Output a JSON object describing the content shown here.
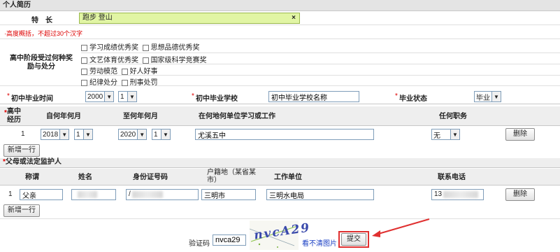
{
  "resume": {
    "section_title": "个人简历",
    "specialty_label": "特　长",
    "specialty_value": "跑步 登山",
    "specialty_clear": "×",
    "specialty_hint": "·高度概括，不超过30个汉字",
    "awards_label": "高中阶段受过何种奖励与处分",
    "awards": [
      "学习成绩优秀奖",
      "思想品德优秀奖",
      "文艺体育优秀奖",
      "国家级科学竞赛奖",
      "劳动模范",
      "好人好事",
      "纪律处分",
      "刑事处罚"
    ],
    "grad_time_label": "初中毕业时间",
    "grad_year": "2000",
    "grad_month": "1",
    "grad_school_label": "初中毕业学校",
    "grad_school_value": "初中毕业学校名称",
    "grad_status_label": "毕业状态",
    "grad_status_value": "毕业",
    "asterisk": "*"
  },
  "history": {
    "label": "高中经历",
    "headers": [
      "自何年何月",
      "至何年何月",
      "在何地何单位学习或工作",
      "任何职务"
    ],
    "row": {
      "index": "1",
      "from_year": "2018",
      "from_month": "1",
      "to_year": "2020",
      "to_month": "1",
      "place": "尤溪五中",
      "position": "无"
    },
    "delete_label": "删除",
    "add_label": "新增一行"
  },
  "guardian": {
    "section_title": "父母或法定监护人",
    "headers": [
      "称谓",
      "姓名",
      "身份证号码",
      "户籍地（某省某市）",
      "工作单位",
      "联系电话"
    ],
    "row": {
      "index": "1",
      "relation": "父亲",
      "id_prefix": "/",
      "hukou": "三明市",
      "employer": "三明水电局",
      "phone_prefix": "13"
    },
    "delete_label": "删除",
    "add_label": "新增一行"
  },
  "captcha": {
    "label": "验证码",
    "value": "nvca29",
    "image_text": "nvcA29",
    "refresh_label": "看不清图片",
    "submit_label": "提交"
  },
  "colors": {
    "highlight": "#e1f5a4",
    "required": "#dd0000",
    "callout": "#e03030"
  }
}
